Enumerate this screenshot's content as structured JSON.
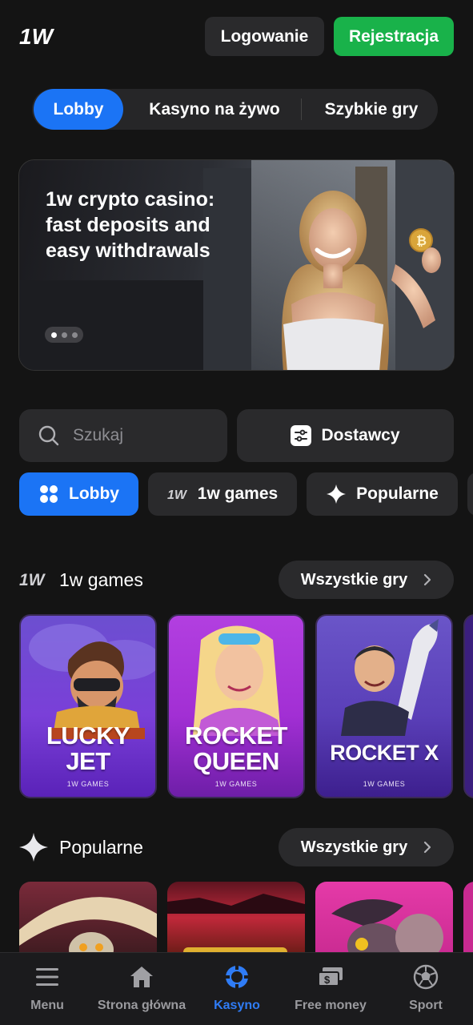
{
  "header": {
    "login_label": "Logowanie",
    "register_label": "Rejestracja"
  },
  "segments": [
    {
      "label": "Lobby",
      "active": true
    },
    {
      "label": "Kasyno na żywo",
      "active": false
    },
    {
      "label": "Szybkie gry",
      "active": false
    }
  ],
  "banner": {
    "title": "1w crypto casino: fast deposits and easy withdrawals",
    "slides": 3,
    "current_slide": 1
  },
  "search": {
    "placeholder": "Szukaj"
  },
  "providers_label": "Dostawcy",
  "chips": [
    {
      "label": "Lobby",
      "icon": "grid-icon",
      "active": true
    },
    {
      "label": "1w games",
      "icon": "1w-logo-icon",
      "active": false
    },
    {
      "label": "Popularne",
      "icon": "sparkle-icon",
      "active": false
    }
  ],
  "sections": {
    "games": {
      "title": "1w games",
      "see_all": "Wszystkie gry",
      "cards": [
        {
          "title": "LUCKY JET",
          "line1": "LUCKY",
          "line2": "JET",
          "provider": "1W GAMES"
        },
        {
          "title": "ROCKET QUEEN",
          "line1": "ROCKET",
          "line2": "QUEEN",
          "provider": "1W GAMES"
        },
        {
          "title": "ROCKET X",
          "line1": "ROCKET X",
          "provider": "1W GAMES"
        }
      ]
    },
    "popular": {
      "title": "Popularne",
      "see_all": "Wszystkie gry"
    }
  },
  "tabbar": [
    {
      "label": "Menu",
      "icon": "menu-icon",
      "active": false
    },
    {
      "label": "Strona główna",
      "icon": "home-icon",
      "active": false
    },
    {
      "label": "Kasyno",
      "icon": "casino-chip-icon",
      "active": true
    },
    {
      "label": "Free money",
      "icon": "money-icon",
      "active": false
    },
    {
      "label": "Sport",
      "icon": "soccer-ball-icon",
      "active": false
    }
  ],
  "colors": {
    "background": "#141414",
    "accent_blue": "#1b74f5",
    "register_green": "#19b24a",
    "surface": "#2a2a2c"
  }
}
